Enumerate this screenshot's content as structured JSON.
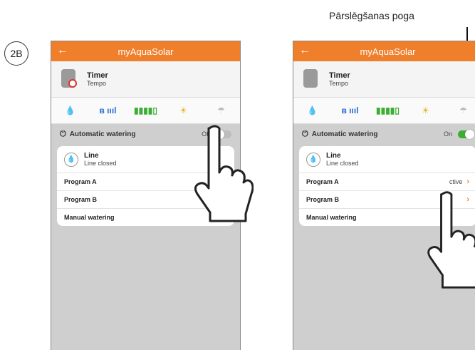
{
  "step_label": "2B",
  "callout_label": "Pārslēgšanas poga",
  "screens": {
    "left": {
      "app_title": "myAquaSolar",
      "device": {
        "name": "Timer",
        "subtitle": "Tempo"
      },
      "automatic_watering": {
        "label": "Automatic watering",
        "state": "Off"
      },
      "line": {
        "name": "Line",
        "status": "Line closed"
      },
      "items": [
        {
          "label": "Program A",
          "value": "No"
        },
        {
          "label": "Program B",
          "value": "No"
        },
        {
          "label": "Manual watering",
          "value": ""
        }
      ]
    },
    "right": {
      "app_title": "myAquaSolar",
      "device": {
        "name": "Timer",
        "subtitle": "Tempo"
      },
      "automatic_watering": {
        "label": "Automatic watering",
        "state": "On"
      },
      "line": {
        "name": "Line",
        "status": "Line closed"
      },
      "items": [
        {
          "label": "Program A",
          "value": "ctive"
        },
        {
          "label": "Program B",
          "value": ""
        },
        {
          "label": "Manual watering",
          "value": ""
        }
      ]
    }
  },
  "icons": {
    "status": [
      "water-drop-icon",
      "bluetooth-signal-icon",
      "battery-icon",
      "sun-icon",
      "umbrella-icon"
    ],
    "back": "back-arrow-icon",
    "hand": "pointing-hand-icon"
  },
  "colors": {
    "accent": "#f07f2c",
    "toggle_on": "#3cae34",
    "battery": "#3cae34",
    "bluetooth": "#2a6fd0"
  }
}
